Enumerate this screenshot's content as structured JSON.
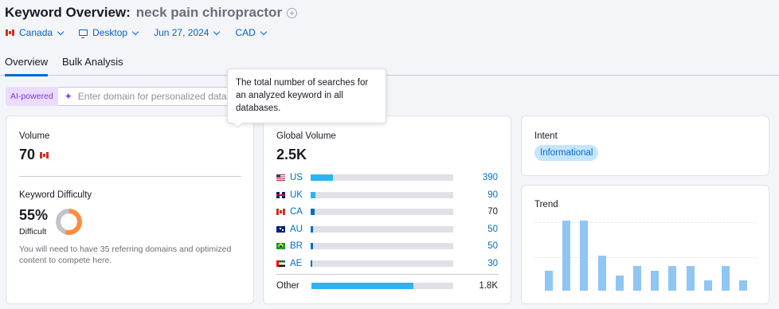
{
  "header": {
    "title_prefix": "Keyword Overview:",
    "keyword": "neck pain chiropractor",
    "add_icon": "plus-circle-icon"
  },
  "filters": {
    "country": "Canada",
    "device": "Desktop",
    "date": "Jun 27, 2024",
    "currency": "CAD"
  },
  "tabs": [
    {
      "label": "Overview",
      "active": true
    },
    {
      "label": "Bulk Analysis",
      "active": false
    }
  ],
  "ai": {
    "badge": "AI-powered",
    "placeholder": "Enter domain for personalized data",
    "icon": "sparkle-icon"
  },
  "tooltip": {
    "text": "The total number of searches for an analyzed keyword in all databases."
  },
  "volume": {
    "label": "Volume",
    "value": "70",
    "flag": "ca"
  },
  "difficulty": {
    "label": "Keyword Difficulty",
    "value": "55%",
    "percent": 55,
    "level": "Difficult",
    "color": "#ff8c43",
    "note": "You will need to have 35 referring domains and optimized content to compete here."
  },
  "global": {
    "label": "Global Volume",
    "value": "2.5K",
    "bar_color": "#2bb4f5",
    "bar_color_dark": "#006dca",
    "countries": [
      {
        "code": "US",
        "flag": "us",
        "value": "390",
        "share": 0.156,
        "linked": true
      },
      {
        "code": "UK",
        "flag": "uk",
        "value": "90",
        "share": 0.036,
        "linked": true
      },
      {
        "code": "CA",
        "flag": "ca",
        "value": "70",
        "share": 0.028,
        "linked": false
      },
      {
        "code": "AU",
        "flag": "au",
        "value": "50",
        "share": 0.02,
        "linked": true
      },
      {
        "code": "BR",
        "flag": "br",
        "value": "50",
        "share": 0.02,
        "linked": true
      },
      {
        "code": "AE",
        "flag": "ae",
        "value": "30",
        "share": 0.012,
        "linked": true
      }
    ],
    "other": {
      "label": "Other",
      "value": "1.8K",
      "share": 0.72
    }
  },
  "intent": {
    "label": "Intent",
    "badge": "Informational"
  },
  "trend": {
    "label": "Trend",
    "values": [
      0.28,
      1.0,
      1.0,
      0.5,
      0.22,
      0.35,
      0.28,
      0.35,
      0.35,
      0.15,
      0.35,
      0.15
    ],
    "bar_color": "#8fc6f2"
  }
}
